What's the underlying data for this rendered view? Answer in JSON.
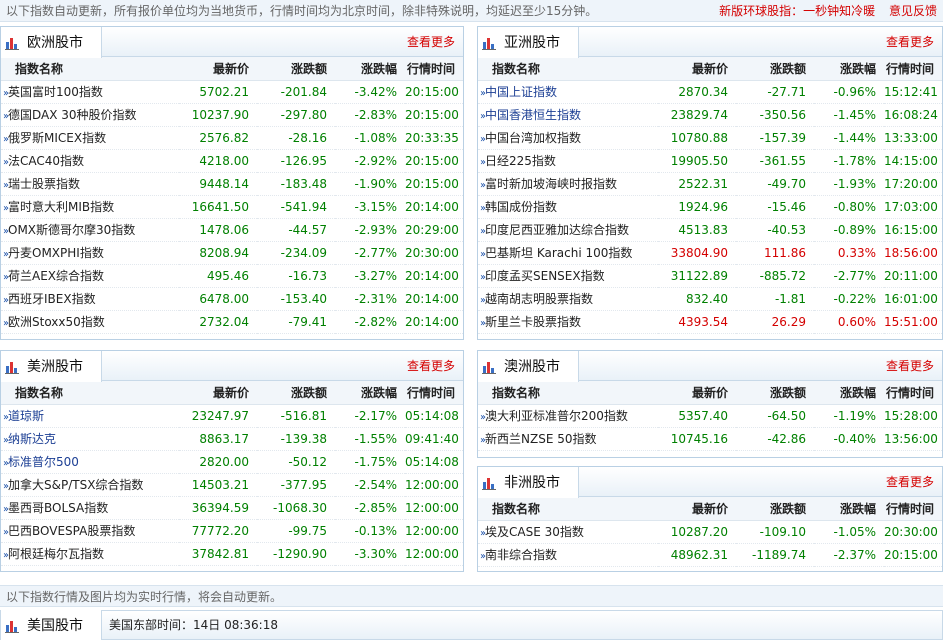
{
  "notice": {
    "left": "以下指数自动更新，所有报价单位均为当地货币，行情时间均为北京时间，除非特殊说明，均延迟至少15分钟。",
    "link1": "新版环球股指：一秒钟知冷暖",
    "link2": "意见反馈"
  },
  "columns": [
    "指数名称",
    "最新价",
    "涨跌额",
    "涨跌幅",
    "行情时间"
  ],
  "more_label": "查看更多",
  "europe": {
    "title": "欧洲股市",
    "rows": [
      {
        "name": "英国富时100指数",
        "price": "5702.21",
        "chg": "-201.84",
        "pct": "-3.42%",
        "time": "20:15:00",
        "dir": "dn",
        "link": false
      },
      {
        "name": "德国DAX 30种股价指数",
        "price": "10237.90",
        "chg": "-297.80",
        "pct": "-2.83%",
        "time": "20:15:00",
        "dir": "dn",
        "link": false
      },
      {
        "name": "俄罗斯MICEX指数",
        "price": "2576.82",
        "chg": "-28.16",
        "pct": "-1.08%",
        "time": "20:33:35",
        "dir": "dn",
        "link": false
      },
      {
        "name": "法CAC40指数",
        "price": "4218.00",
        "chg": "-126.95",
        "pct": "-2.92%",
        "time": "20:15:00",
        "dir": "dn",
        "link": false
      },
      {
        "name": "瑞士股票指数",
        "price": "9448.14",
        "chg": "-183.48",
        "pct": "-1.90%",
        "time": "20:15:00",
        "dir": "dn",
        "link": false
      },
      {
        "name": "富时意大利MIB指数",
        "price": "16641.50",
        "chg": "-541.94",
        "pct": "-3.15%",
        "time": "20:14:00",
        "dir": "dn",
        "link": false
      },
      {
        "name": "OMX斯德哥尔摩30指数",
        "price": "1478.06",
        "chg": "-44.57",
        "pct": "-2.93%",
        "time": "20:29:00",
        "dir": "dn",
        "link": false
      },
      {
        "name": "丹麦OMXPHI指数",
        "price": "8208.94",
        "chg": "-234.09",
        "pct": "-2.77%",
        "time": "20:30:00",
        "dir": "dn",
        "link": false
      },
      {
        "name": "荷兰AEX综合指数",
        "price": "495.46",
        "chg": "-16.73",
        "pct": "-3.27%",
        "time": "20:14:00",
        "dir": "dn",
        "link": false
      },
      {
        "name": "西班牙IBEX指数",
        "price": "6478.00",
        "chg": "-153.40",
        "pct": "-2.31%",
        "time": "20:14:00",
        "dir": "dn",
        "link": false
      },
      {
        "name": "欧洲Stoxx50指数",
        "price": "2732.04",
        "chg": "-79.41",
        "pct": "-2.82%",
        "time": "20:14:00",
        "dir": "dn",
        "link": false
      }
    ]
  },
  "asia": {
    "title": "亚洲股市",
    "rows": [
      {
        "name": "中国上证指数",
        "price": "2870.34",
        "chg": "-27.71",
        "pct": "-0.96%",
        "time": "15:12:41",
        "dir": "dn",
        "link": true
      },
      {
        "name": "中国香港恒生指数",
        "price": "23829.74",
        "chg": "-350.56",
        "pct": "-1.45%",
        "time": "16:08:24",
        "dir": "dn",
        "link": true
      },
      {
        "name": "中国台湾加权指数",
        "price": "10780.88",
        "chg": "-157.39",
        "pct": "-1.44%",
        "time": "13:33:00",
        "dir": "dn",
        "link": false
      },
      {
        "name": "日经225指数",
        "price": "19905.50",
        "chg": "-361.55",
        "pct": "-1.78%",
        "time": "14:15:00",
        "dir": "dn",
        "link": false
      },
      {
        "name": "富时新加坡海峡时报指数",
        "price": "2522.31",
        "chg": "-49.70",
        "pct": "-1.93%",
        "time": "17:20:00",
        "dir": "dn",
        "link": false
      },
      {
        "name": "韩国成份指数",
        "price": "1924.96",
        "chg": "-15.46",
        "pct": "-0.80%",
        "time": "17:03:00",
        "dir": "dn",
        "link": false
      },
      {
        "name": "印度尼西亚雅加达综合指数",
        "price": "4513.83",
        "chg": "-40.53",
        "pct": "-0.89%",
        "time": "16:15:00",
        "dir": "dn",
        "link": false
      },
      {
        "name": "巴基斯坦 Karachi 100指数",
        "price": "33804.90",
        "chg": "111.86",
        "pct": "0.33%",
        "time": "18:56:00",
        "dir": "up",
        "link": false
      },
      {
        "name": "印度孟买SENSEX指数",
        "price": "31122.89",
        "chg": "-885.72",
        "pct": "-2.77%",
        "time": "20:11:00",
        "dir": "dn",
        "link": false
      },
      {
        "name": "越南胡志明股票指数",
        "price": "832.40",
        "chg": "-1.81",
        "pct": "-0.22%",
        "time": "16:01:00",
        "dir": "dn",
        "link": false
      },
      {
        "name": "斯里兰卡股票指数",
        "price": "4393.54",
        "chg": "26.29",
        "pct": "0.60%",
        "time": "15:51:00",
        "dir": "up",
        "link": false
      }
    ]
  },
  "america": {
    "title": "美洲股市",
    "rows": [
      {
        "name": "道琼斯",
        "price": "23247.97",
        "chg": "-516.81",
        "pct": "-2.17%",
        "time": "05:14:08",
        "dir": "dn",
        "link": true
      },
      {
        "name": "纳斯达克",
        "price": "8863.17",
        "chg": "-139.38",
        "pct": "-1.55%",
        "time": "09:41:40",
        "dir": "dn",
        "link": true
      },
      {
        "name": "标准普尔500",
        "price": "2820.00",
        "chg": "-50.12",
        "pct": "-1.75%",
        "time": "05:14:08",
        "dir": "dn",
        "link": true
      },
      {
        "name": "加拿大S&P/TSX综合指数",
        "price": "14503.21",
        "chg": "-377.95",
        "pct": "-2.54%",
        "time": "12:00:00",
        "dir": "dn",
        "link": false
      },
      {
        "name": "墨西哥BOLSA指数",
        "price": "36394.59",
        "chg": "-1068.30",
        "pct": "-2.85%",
        "time": "12:00:00",
        "dir": "dn",
        "link": false
      },
      {
        "name": "巴西BOVESPA股票指数",
        "price": "77772.20",
        "chg": "-99.75",
        "pct": "-0.13%",
        "time": "12:00:00",
        "dir": "dn",
        "link": false
      },
      {
        "name": "阿根廷梅尔瓦指数",
        "price": "37842.81",
        "chg": "-1290.90",
        "pct": "-3.30%",
        "time": "12:00:00",
        "dir": "dn",
        "link": false
      }
    ]
  },
  "oceania": {
    "title": "澳洲股市",
    "rows": [
      {
        "name": "澳大利亚标准普尔200指数",
        "price": "5357.40",
        "chg": "-64.50",
        "pct": "-1.19%",
        "time": "15:28:00",
        "dir": "dn",
        "link": false
      },
      {
        "name": "新西兰NZSE 50指数",
        "price": "10745.16",
        "chg": "-42.86",
        "pct": "-0.40%",
        "time": "13:56:00",
        "dir": "dn",
        "link": false
      }
    ]
  },
  "africa": {
    "title": "非洲股市",
    "rows": [
      {
        "name": "埃及CASE 30指数",
        "price": "10287.20",
        "chg": "-109.10",
        "pct": "-1.05%",
        "time": "20:30:00",
        "dir": "dn",
        "link": false
      },
      {
        "name": "南非综合指数",
        "price": "48962.31",
        "chg": "-1189.74",
        "pct": "-2.37%",
        "time": "20:15:00",
        "dir": "dn",
        "link": false
      }
    ]
  },
  "footer_note": "以下指数行情及图片均为实时行情，将会自动更新。",
  "us_bar": {
    "title": "美国股市",
    "clock": "美国东部时间：14日 08:36:18"
  },
  "colors": {
    "up": "#d40000",
    "down": "#008000",
    "link": "#1c3f94",
    "accent": "#d40000"
  }
}
